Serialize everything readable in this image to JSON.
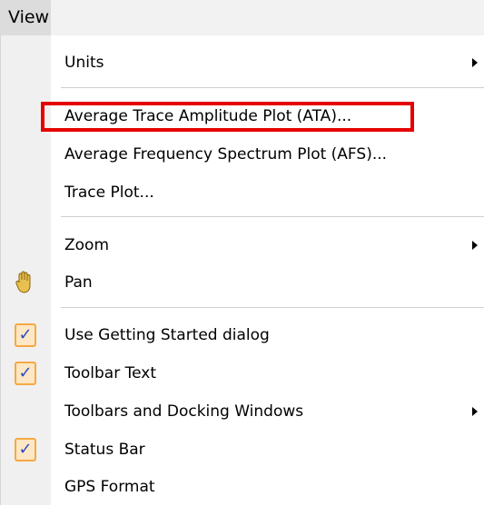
{
  "menubar": {
    "view_label": "View"
  },
  "menu": {
    "units": "Units",
    "ata": "Average Trace Amplitude Plot (ATA)...",
    "afs": "Average Frequency Spectrum Plot (AFS)...",
    "trace_plot": "Trace Plot...",
    "zoom": "Zoom",
    "pan": "Pan",
    "getting_started": "Use Getting Started dialog",
    "toolbar_text": "Toolbar Text",
    "toolbars_docking": "Toolbars and Docking Windows",
    "status_bar": "Status Bar",
    "gps_format": "GPS Format"
  },
  "check_glyph": "✓",
  "checked_items": [
    "Use Getting Started dialog",
    "Toolbar Text",
    "Status Bar"
  ],
  "highlighted_item": "Average Trace Amplitude Plot (ATA)...",
  "icons": {
    "pan": "hand-icon",
    "submenu": "chevron-right-icon",
    "check": "checkmark-icon"
  },
  "colors": {
    "highlight_border": "#e50000",
    "check_border": "#f5a943",
    "check_fill": "#fde7c4",
    "check_mark": "#2e4dbd",
    "gutter": "#f0f0f0"
  }
}
